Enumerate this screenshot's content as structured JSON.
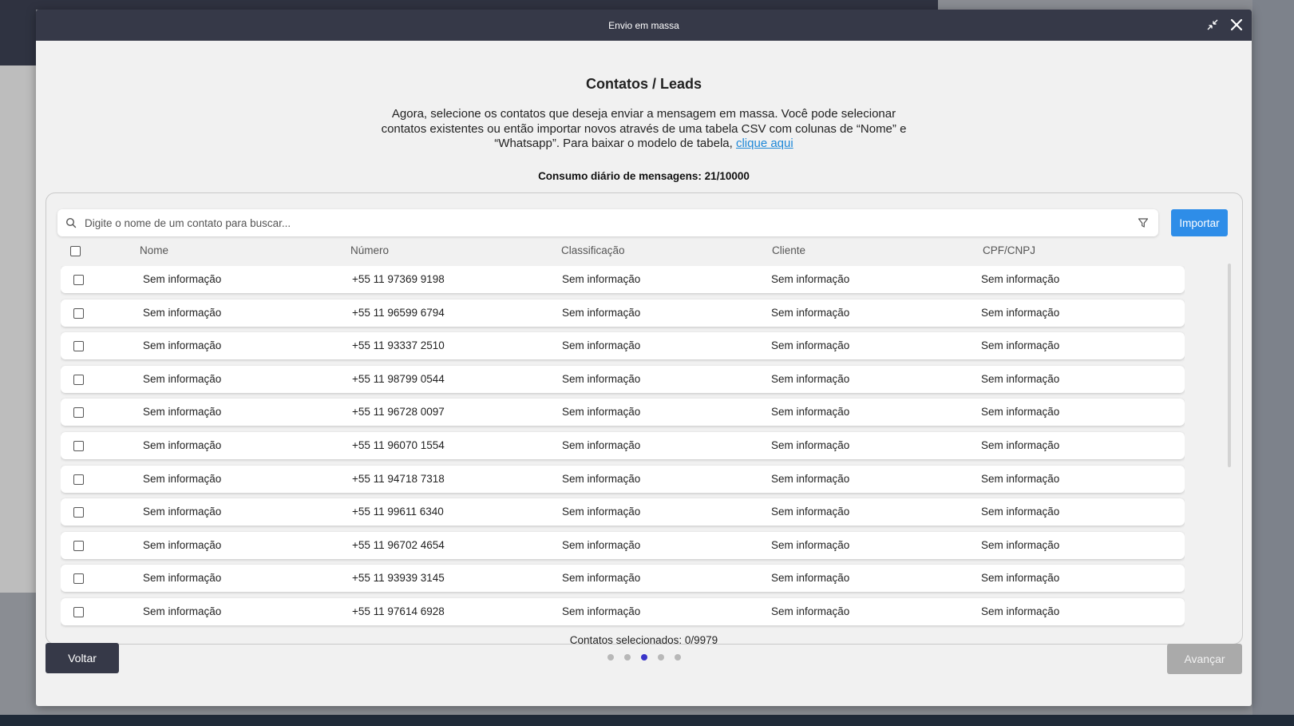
{
  "modal": {
    "title": "Envio em massa"
  },
  "page": {
    "title": "Contatos / Leads",
    "instructions_text": "Agora, selecione os contatos que deseja enviar a mensagem em massa. Você pode selecionar contatos existentes ou então importar novos através de uma tabela CSV com colunas de “Nome” e “Whatsapp”. Para baixar o modelo de tabela, ",
    "instructions_link": "clique aqui",
    "consumo": "Consumo diário de mensagens: 21/10000"
  },
  "search": {
    "placeholder": "Digite o nome de um contato para buscar...",
    "import_label": "Importar"
  },
  "table": {
    "headers": [
      "Nome",
      "Número",
      "Classificação",
      "Cliente",
      "CPF/CNPJ"
    ],
    "rows": [
      [
        "Sem informação",
        "+55 11 97369 9198",
        "Sem informação",
        "Sem informação",
        "Sem informação"
      ],
      [
        "Sem informação",
        "+55 11 96599 6794",
        "Sem informação",
        "Sem informação",
        "Sem informação"
      ],
      [
        "Sem informação",
        "+55 11 93337 2510",
        "Sem informação",
        "Sem informação",
        "Sem informação"
      ],
      [
        "Sem informação",
        "+55 11 98799 0544",
        "Sem informação",
        "Sem informação",
        "Sem informação"
      ],
      [
        "Sem informação",
        "+55 11 96728 0097",
        "Sem informação",
        "Sem informação",
        "Sem informação"
      ],
      [
        "Sem informação",
        "+55 11 96070 1554",
        "Sem informação",
        "Sem informação",
        "Sem informação"
      ],
      [
        "Sem informação",
        "+55 11 94718 7318",
        "Sem informação",
        "Sem informação",
        "Sem informação"
      ],
      [
        "Sem informação",
        "+55 11 99611 6340",
        "Sem informação",
        "Sem informação",
        "Sem informação"
      ],
      [
        "Sem informação",
        "+55 11 96702 4654",
        "Sem informação",
        "Sem informação",
        "Sem informação"
      ],
      [
        "Sem informação",
        "+55 11 93939 3145",
        "Sem informação",
        "Sem informação",
        "Sem informação"
      ],
      [
        "Sem informação",
        "+55 11 97614 6928",
        "Sem informação",
        "Sem informação",
        "Sem informação"
      ]
    ]
  },
  "footer": {
    "selected": "Contatos selecionados: 0/9979",
    "back_label": "Voltar",
    "next_label": "Avançar",
    "steps_total": 5,
    "current_step": 3
  },
  "colors": {
    "header_bg": "#363948",
    "accent": "#2e8de8",
    "active_step": "#3a35c9",
    "disabled_button": "#aaaaaa"
  },
  "icons": [
    "minimize-icon",
    "close-icon",
    "search-icon",
    "filter-icon"
  ]
}
